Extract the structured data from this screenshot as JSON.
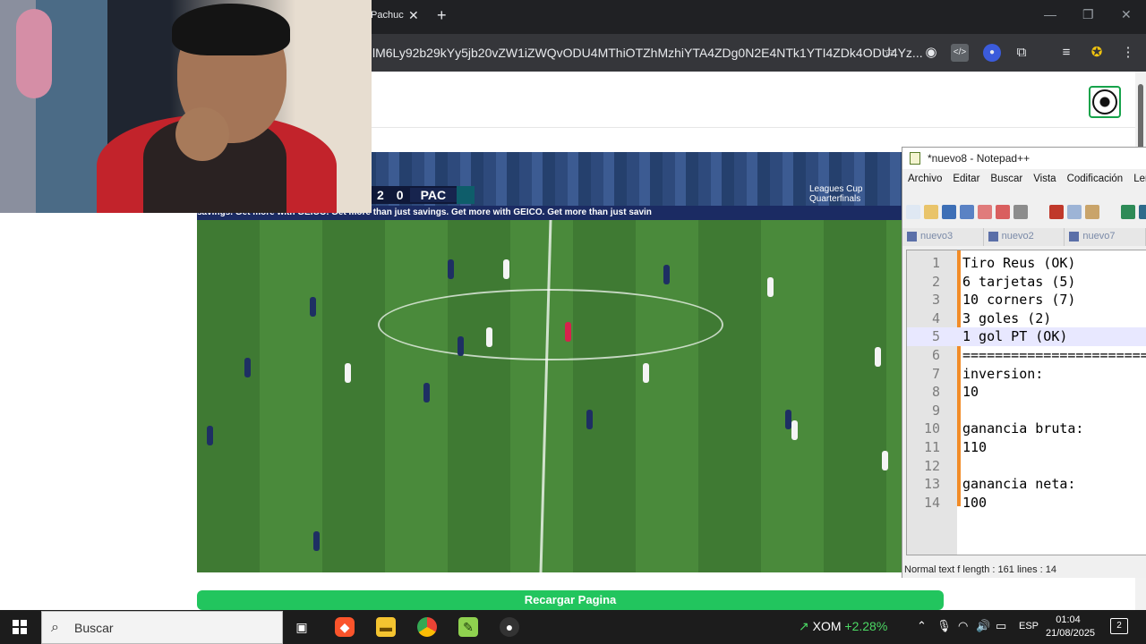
{
  "browser": {
    "tab_title": "Pachuc",
    "tab_close": "✕",
    "new_tab": "+",
    "url": "lM6Ly92b29kYy5jb20vZW1iZWQvODU4MThiOTZhMzhiYTA4ZDg0N2E4NTk1YTI4ZDk4ODU4Yz...",
    "window_controls": {
      "minimize": "—",
      "maximize": "❐",
      "close": "✕"
    }
  },
  "page": {
    "reload_label": "Recargar Pagina"
  },
  "video": {
    "score_home": "2",
    "score_away": "0",
    "team_away": "PAC",
    "competition_line1": "Leagues Cup",
    "competition_line2": "Quarterfinals",
    "ad_text": "savings. Get more with GEICO.   Get more than just savings. Get more with GEICO.   Get more than just savin"
  },
  "notepad": {
    "title": "*nuevo8 - Notepad++",
    "menu": [
      "Archivo",
      "Editar",
      "Buscar",
      "Vista",
      "Codificación",
      "Len"
    ],
    "tabs": [
      "nuevo3",
      "nuevo2",
      "nuevo7"
    ],
    "lines": [
      {
        "n": "1",
        "t": "Tiro Reus (OK)"
      },
      {
        "n": "2",
        "t": "6 tarjetas (5)"
      },
      {
        "n": "3",
        "t": "10 corners (7)"
      },
      {
        "n": "4",
        "t": "3 goles (2)"
      },
      {
        "n": "5",
        "t": "1 gol PT (OK)"
      },
      {
        "n": "6",
        "t": "=========================="
      },
      {
        "n": "7",
        "t": "inversion:"
      },
      {
        "n": "8",
        "t": "10"
      },
      {
        "n": "9",
        "t": ""
      },
      {
        "n": "10",
        "t": "ganancia bruta:"
      },
      {
        "n": "11",
        "t": "110"
      },
      {
        "n": "12",
        "t": ""
      },
      {
        "n": "13",
        "t": "ganancia neta:"
      },
      {
        "n": "14",
        "t": "100"
      }
    ],
    "current_line": 5,
    "status": "Normal text f  length : 161    lines : 14"
  },
  "taskbar": {
    "search_placeholder": "Buscar",
    "stock_symbol": "XOM",
    "stock_change": "+2.28%",
    "language": "ESP",
    "time": "01:04",
    "date": "21/08/2025",
    "notifications": "2"
  },
  "colors": {
    "reload_button": "#22c55e",
    "notepad_fold": "#f28c28",
    "stock_up": "#4cd964"
  }
}
